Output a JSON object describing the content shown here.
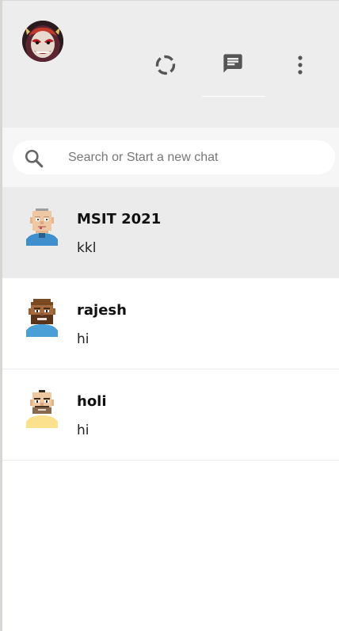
{
  "header": {
    "profile_avatar_alt": "profile avatar",
    "icons": {
      "status": "status-icon",
      "new_chat": "chat-icon",
      "menu": "more-vert-icon"
    }
  },
  "search": {
    "placeholder": "Search or Start a new chat"
  },
  "conversations": [
    {
      "name": "MSIT 2021",
      "last_message": "kkl",
      "active": true,
      "avatar": "pixel-avatar-bald-blue-shirt"
    },
    {
      "name": "rajesh",
      "last_message": "hi",
      "active": false,
      "avatar": "pixel-avatar-beard-brown"
    },
    {
      "name": "holi",
      "last_message": "hi",
      "active": false,
      "avatar": "pixel-avatar-mustache-yellow-shirt"
    }
  ],
  "colors": {
    "header_bg": "#ededed",
    "search_bg": "#f6f6f6",
    "active_row": "#ebebeb",
    "icon_gray": "#555555"
  }
}
